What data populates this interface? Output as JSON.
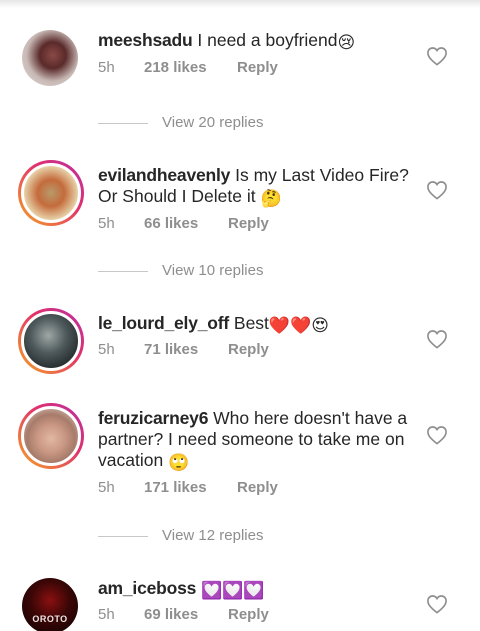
{
  "comments": [
    {
      "username": "meeshsadu",
      "text": "I need a boyfriend",
      "emoji": "😢",
      "time": "5h",
      "likes": "218 likes",
      "reply_label": "Reply",
      "view_replies": "View 20 replies"
    },
    {
      "username": "evilandheavenly",
      "text": "Is my Last Video Fire? Or Should I Delete it",
      "emoji": "🤔",
      "time": "5h",
      "likes": "66 likes",
      "reply_label": "Reply",
      "view_replies": "View 10 replies"
    },
    {
      "username": "le_lourd_ely_off",
      "text": "Best",
      "emoji": "❤️❤️😍",
      "time": "5h",
      "likes": "71 likes",
      "reply_label": "Reply"
    },
    {
      "username": "feruzicarney6",
      "text": "Who here doesn't have a partner? I need someone to take me on vacation",
      "emoji": "🙄",
      "time": "5h",
      "likes": "171 likes",
      "reply_label": "Reply",
      "view_replies": "View 12 replies"
    },
    {
      "username": "am_iceboss",
      "text": "",
      "emoji": "💟💟💟",
      "time": "5h",
      "likes": "69 likes",
      "reply_label": "Reply"
    }
  ],
  "colors": {
    "text": "#262626",
    "secondary": "#8e8e8e",
    "story_ring_start": "#f5a623",
    "story_ring_end": "#b72fa8"
  },
  "icons": {
    "like": "heart-outline-icon"
  },
  "avatar_5_text": "OROTO"
}
